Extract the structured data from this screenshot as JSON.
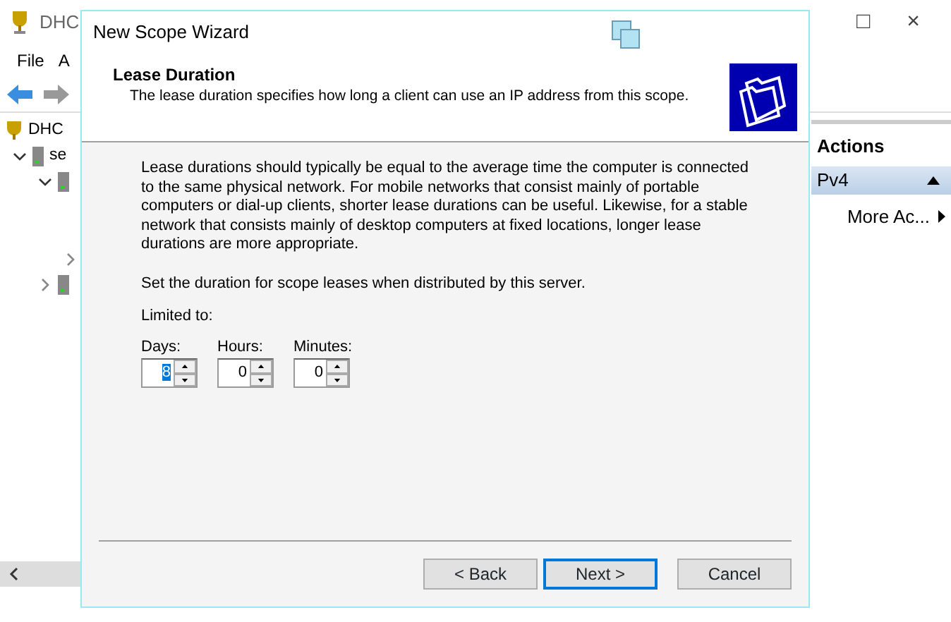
{
  "main_window": {
    "title": "DHC",
    "window_controls": [
      "□",
      "×"
    ],
    "menu": [
      "File",
      "A"
    ],
    "tree": [
      {
        "label": "DHC",
        "children": [
          {
            "label": "se",
            "expanded": true,
            "children": [
              {
                "expanded": true,
                "children": [
                  {
                    "expanded": false
                  }
                ]
              },
              {
                "expanded": false
              }
            ]
          }
        ]
      }
    ],
    "actions": {
      "title": "Actions",
      "items": [
        {
          "kind": "section",
          "label": "Pv4"
        },
        {
          "kind": "action",
          "label": "More Ac..."
        }
      ]
    }
  },
  "wizard": {
    "title": "New Scope Wizard",
    "heading": "Lease Duration",
    "subheading": "The lease duration specifies how long a client can use an IP address from this scope.",
    "paragraphs": [
      "Lease durations should typically be equal to the average time the computer is connected to the same physical network. For mobile networks that consist mainly of portable computers or dial-up clients, shorter lease durations can be useful. Likewise, for a stable network that consists mainly of desktop computers at fixed locations, longer lease durations are more appropriate.",
      "Set the duration for scope leases when distributed by this server."
    ],
    "group_label": "Limited to:",
    "spinners": [
      {
        "label": "Days:",
        "value": "8",
        "selected": true
      },
      {
        "label": "Hours:",
        "value": "0",
        "selected": false
      },
      {
        "label": "Minutes:",
        "value": "0",
        "selected": false
      }
    ],
    "buttons": [
      {
        "label": "< Back",
        "default": false
      },
      {
        "label": "Next >",
        "default": true
      },
      {
        "label": "Cancel",
        "default": false
      }
    ]
  }
}
